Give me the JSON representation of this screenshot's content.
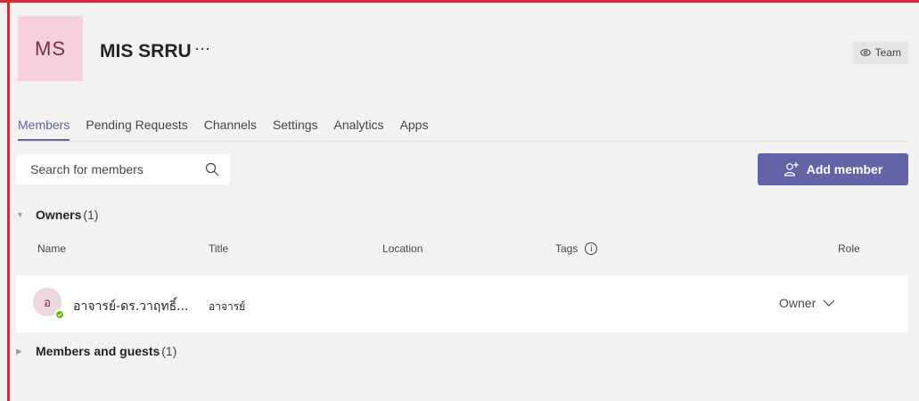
{
  "team": {
    "initials": "MS",
    "name": "MIS SRRU",
    "more": "···",
    "badge_label": "Team",
    "badge_icon": "eye-icon"
  },
  "tabs": [
    {
      "label": "Members",
      "active": true
    },
    {
      "label": "Pending Requests",
      "active": false
    },
    {
      "label": "Channels",
      "active": false
    },
    {
      "label": "Settings",
      "active": false
    },
    {
      "label": "Analytics",
      "active": false
    },
    {
      "label": "Apps",
      "active": false
    }
  ],
  "search": {
    "placeholder": "Search for members",
    "icon": "search-icon"
  },
  "add_member": {
    "label": "Add member",
    "icon": "add-person-icon"
  },
  "owners": {
    "title": "Owners",
    "count": "(1)",
    "expanded": true
  },
  "columns": {
    "name": "Name",
    "title": "Title",
    "location": "Location",
    "tags": "Tags",
    "role": "Role"
  },
  "members": [
    {
      "initial": "อ",
      "name": "อาจารย์-ดร.วาฤทธิ์...",
      "title": "อาจารย์",
      "role": "Owner",
      "presence": "available",
      "presence_color": "#6bb700"
    }
  ],
  "guests": {
    "title": "Members and guests",
    "count": "(1)",
    "expanded": false
  },
  "colors": {
    "accent": "#6264a7",
    "frame": "#e0232e",
    "avatar_bg": "#f6d1dc"
  }
}
